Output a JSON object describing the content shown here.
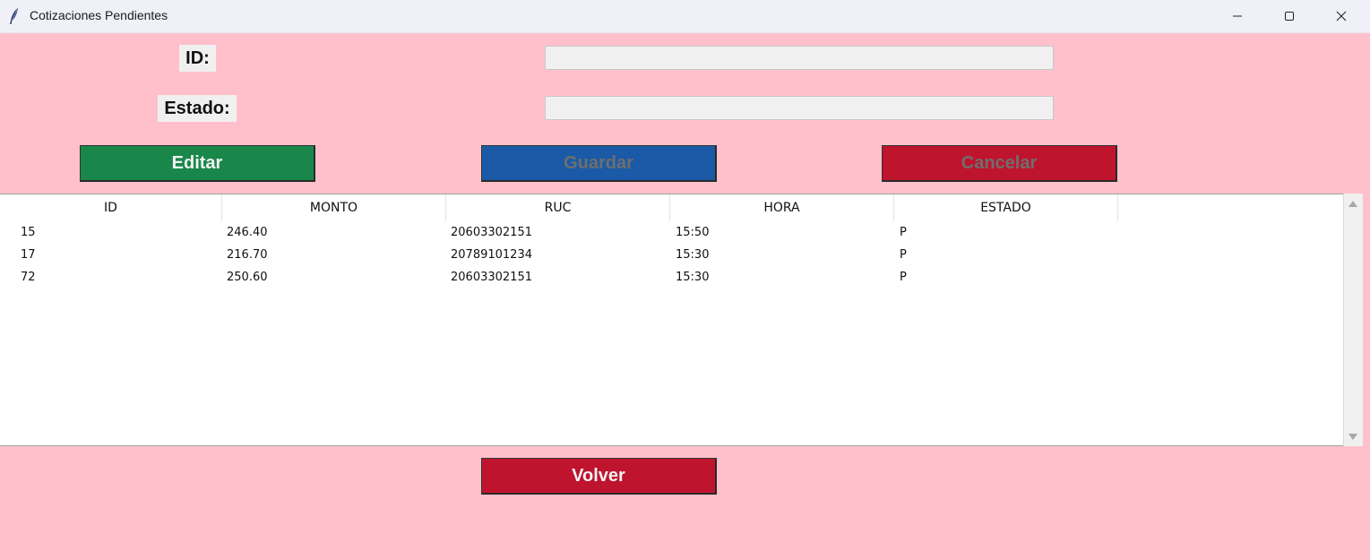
{
  "window": {
    "title": "Cotizaciones Pendientes",
    "icon": "feather-icon",
    "controls": [
      "minimize-icon",
      "maximize-icon",
      "close-icon"
    ]
  },
  "form": {
    "id_label": "ID:",
    "id_value": "",
    "estado_label": "Estado:",
    "estado_value": ""
  },
  "buttons": {
    "editar": "Editar",
    "guardar": "Guardar",
    "cancelar": "Cancelar",
    "volver": "Volver"
  },
  "table": {
    "columns": [
      "ID",
      "MONTO",
      "RUC",
      "HORA",
      "ESTADO"
    ],
    "rows": [
      [
        "15",
        "246.40",
        "20603302151",
        "15:50",
        "P"
      ],
      [
        "17",
        "216.70",
        "20789101234",
        "15:30",
        "P"
      ],
      [
        "72",
        "250.60",
        "20603302151",
        "15:30",
        "P"
      ]
    ]
  },
  "colors": {
    "background": "#ffc0cb",
    "editar_button": "#19874a",
    "guardar_button": "#1a5aa6",
    "cancelar_button": "#bf142e",
    "volver_button": "#bf142e"
  }
}
